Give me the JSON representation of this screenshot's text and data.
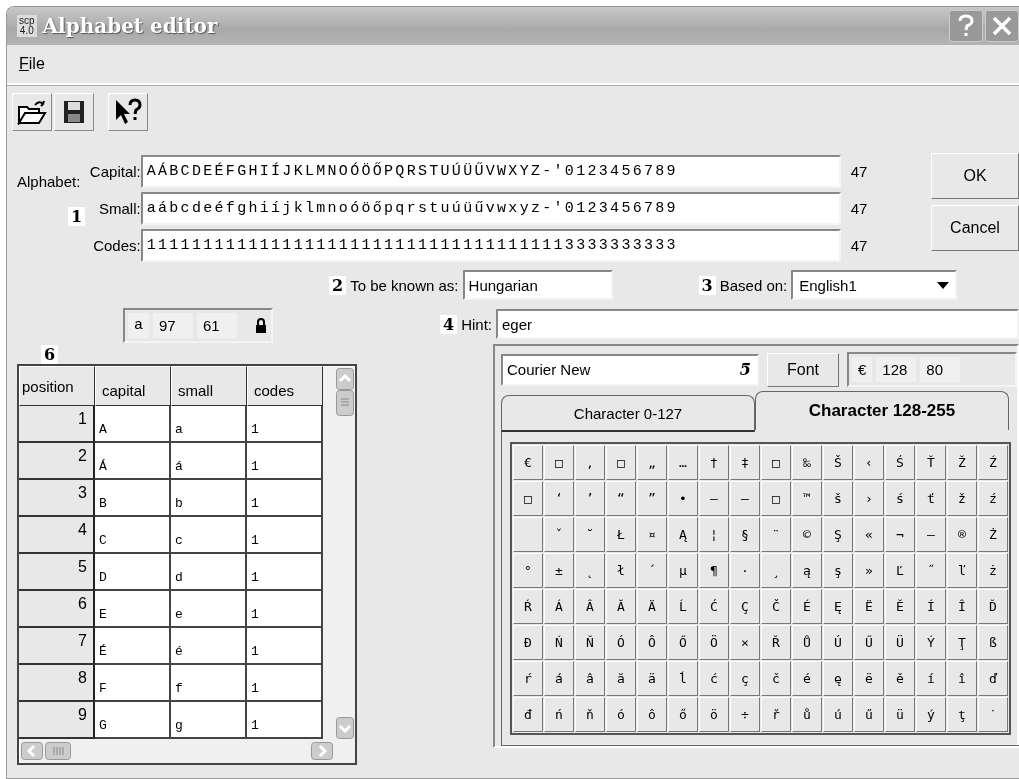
{
  "window": {
    "title": "Alphabet editor",
    "app_badge": [
      "scp",
      "4.0"
    ]
  },
  "menu": [
    {
      "label": "File"
    }
  ],
  "alphabet": {
    "label": "Alphabet:",
    "marker": "1",
    "rows": [
      {
        "label": "Capital:",
        "value": "AÁBCDEÉFGHIÍJKLMNOÓÖŐPQRSTUÚÜŰVWXYZ-'0123456789",
        "count": "47"
      },
      {
        "label": "Small:",
        "value": "aábcdeéfghiíjklmnoóöőpqrstuúüűvwxyz-'0123456789",
        "count": "47"
      },
      {
        "label": "Codes:",
        "value": "11111111111111111111111111111111111113333333333",
        "count": "47"
      }
    ]
  },
  "buttons": [
    "OK",
    "Cancel"
  ],
  "known_as": {
    "marker": "2",
    "label": "To be known as:",
    "value": "Hungarian"
  },
  "based_on": {
    "marker": "3",
    "label": "Based on:",
    "value": "English1"
  },
  "char_info": {
    "char": "a",
    "decimal": "97",
    "hex": "61",
    "locked": true
  },
  "hint": {
    "marker": "4",
    "label": "Hint:",
    "value": "eger"
  },
  "font": {
    "value": "Courier New",
    "marker": "5",
    "button": "Font",
    "char": "€",
    "decimal": "128",
    "hex": "80"
  },
  "tabs": [
    {
      "label": "Character 0-127",
      "selected": false
    },
    {
      "label": "Character 128-255",
      "selected": true
    }
  ],
  "char_grid": [
    [
      "€",
      "□",
      "‚",
      "□",
      "„",
      "…",
      "†",
      "‡",
      "□",
      "‰",
      "Š",
      "‹",
      "Ś",
      "Ť",
      "Ž",
      "Ź"
    ],
    [
      "□",
      "‘",
      "’",
      "“",
      "”",
      "•",
      "–",
      "—",
      "□",
      "™",
      "š",
      "›",
      "ś",
      "ť",
      "ž",
      "ź"
    ],
    [
      {
        "kind": "blank"
      },
      "ˇ",
      "˘",
      "Ł",
      "¤",
      "Ą",
      "¦",
      "§",
      "¨",
      "©",
      "Ş",
      "«",
      "¬",
      "–",
      "®",
      "Ż"
    ],
    [
      "°",
      "±",
      "˛",
      "ł",
      "´",
      "µ",
      "¶",
      "·",
      "¸",
      "ą",
      "ş",
      "»",
      "Ľ",
      "˝",
      "ľ",
      "ż"
    ],
    [
      "Ŕ",
      "Á",
      "Â",
      "Ă",
      "Ä",
      "Ĺ",
      "Ć",
      "Ç",
      "Č",
      "É",
      "Ę",
      "Ë",
      "Ě",
      "Í",
      "Î",
      "Ď"
    ],
    [
      "Đ",
      "Ń",
      "Ň",
      "Ó",
      "Ô",
      "Ő",
      "Ö",
      "×",
      "Ř",
      "Ů",
      "Ú",
      "Ű",
      "Ü",
      "Ý",
      "Ţ",
      "ß"
    ],
    [
      "ŕ",
      "á",
      "â",
      "ă",
      "ä",
      "ĺ",
      "ć",
      "ç",
      "č",
      "é",
      "ę",
      "ë",
      "ě",
      "í",
      "î",
      "ď"
    ],
    [
      "đ",
      "ń",
      "ň",
      "ó",
      "ô",
      "ő",
      "ö",
      "÷",
      "ř",
      "ů",
      "ú",
      "ű",
      "ü",
      "ý",
      "ţ",
      "˙"
    ]
  ],
  "table": {
    "marker": "6",
    "columns": [
      "position",
      "capital",
      "small",
      "codes"
    ],
    "rows": [
      [
        "1",
        "A",
        "a",
        "1"
      ],
      [
        "2",
        "Á",
        "á",
        "1"
      ],
      [
        "3",
        "B",
        "b",
        "1"
      ],
      [
        "4",
        "C",
        "c",
        "1"
      ],
      [
        "5",
        "D",
        "d",
        "1"
      ],
      [
        "6",
        "E",
        "e",
        "1"
      ],
      [
        "7",
        "É",
        "é",
        "1"
      ],
      [
        "8",
        "F",
        "f",
        "1"
      ],
      [
        "9",
        "G",
        "g",
        "1"
      ]
    ]
  }
}
